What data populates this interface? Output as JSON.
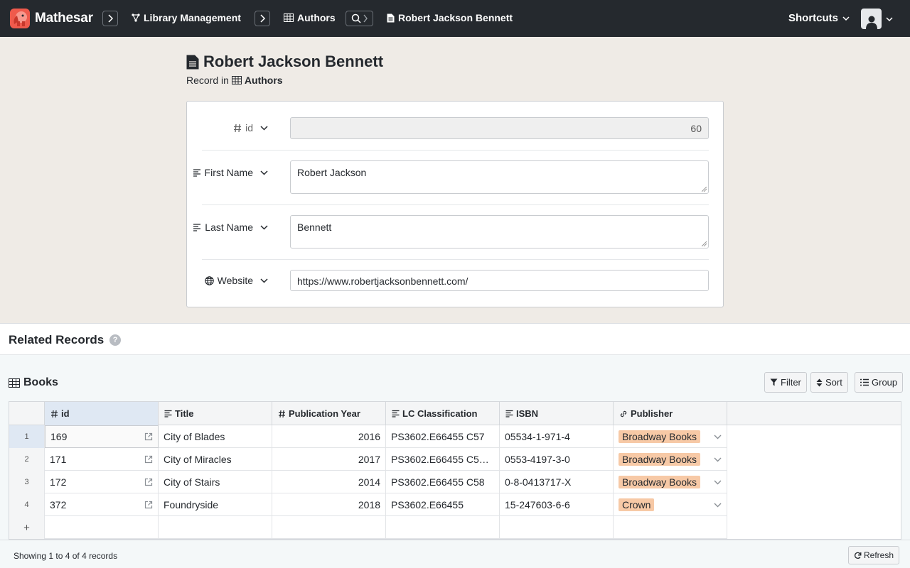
{
  "app": {
    "name": "Mathesar"
  },
  "breadcrumb": {
    "schema": "Library Management",
    "table": "Authors",
    "record": "Robert Jackson Bennett"
  },
  "header": {
    "shortcuts_label": "Shortcuts"
  },
  "record": {
    "title": "Robert Jackson Bennett",
    "subtitle_prefix": "Record in",
    "table_name": "Authors"
  },
  "fields": [
    {
      "label": "id",
      "icon": "hash-icon",
      "value": "60",
      "readonly": true
    },
    {
      "label": "First Name",
      "icon": "text-icon",
      "value": "Robert Jackson"
    },
    {
      "label": "Last Name",
      "icon": "text-icon",
      "value": "Bennett"
    },
    {
      "label": "Website",
      "icon": "globe-icon",
      "value": "https://www.robertjacksonbennett.com/"
    }
  ],
  "related": {
    "title": "Related Records",
    "help": "?",
    "table_title": "Books",
    "toolbar": {
      "filter": "Filter",
      "sort": "Sort",
      "group": "Group"
    },
    "columns": [
      "id",
      "Title",
      "Publication Year",
      "LC Classification",
      "ISBN",
      "Publisher"
    ],
    "rows": [
      {
        "num": "1",
        "id": "169",
        "title": "City of Blades",
        "year": "2016",
        "lc": "PS3602.E66455 C57",
        "isbn": "05534-1-971-4",
        "publisher": "Broadway Books"
      },
      {
        "num": "2",
        "id": "171",
        "title": "City of Miracles",
        "year": "2017",
        "lc": "PS3602.E66455 C5…",
        "isbn": "0553-4197-3-0",
        "publisher": "Broadway Books"
      },
      {
        "num": "3",
        "id": "172",
        "title": "City of Stairs",
        "year": "2014",
        "lc": "PS3602.E66455 C58",
        "isbn": "0-8-0413717-X",
        "publisher": "Broadway Books"
      },
      {
        "num": "4",
        "id": "372",
        "title": "Foundryside",
        "year": "2018",
        "lc": "PS3602.E66455",
        "isbn": "15-247603-6-6",
        "publisher": "Crown"
      }
    ],
    "add_row": "+",
    "status": "Showing 1 to 4 of 4 records",
    "refresh": "Refresh"
  }
}
